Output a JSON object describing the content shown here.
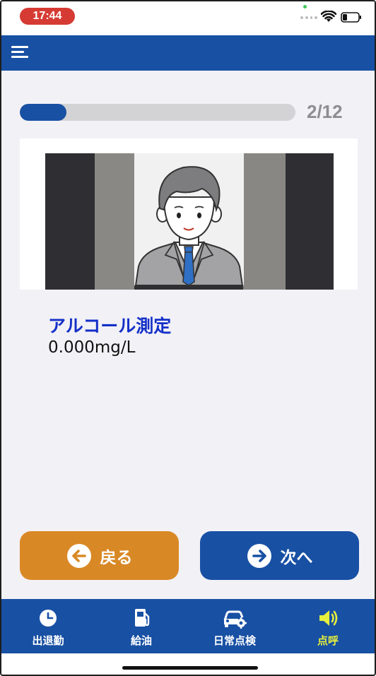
{
  "status_bar": {
    "time": "17:44"
  },
  "header": {
    "menu_icon": "hamburger-menu-icon"
  },
  "progress": {
    "current": 2,
    "total": 12,
    "text": "2/12",
    "fill_fraction": 0.17
  },
  "measurement": {
    "label": "アルコール測定",
    "value": "0.000mg/L"
  },
  "buttons": {
    "back_label": "戻る",
    "next_label": "次へ"
  },
  "tabs": [
    {
      "label": "出退勤",
      "icon": "clock-icon",
      "active": false
    },
    {
      "label": "給油",
      "icon": "fuel-pump-icon",
      "active": false
    },
    {
      "label": "日常点検",
      "icon": "car-gear-icon",
      "active": false
    },
    {
      "label": "点呼",
      "icon": "speaker-icon",
      "active": true
    }
  ],
  "colors": {
    "primary": "#1850a4",
    "back_button": "#d98826",
    "label_blue": "#1430c8",
    "active_tab": "#e6ef3c",
    "status_pill": "#d63b33"
  }
}
